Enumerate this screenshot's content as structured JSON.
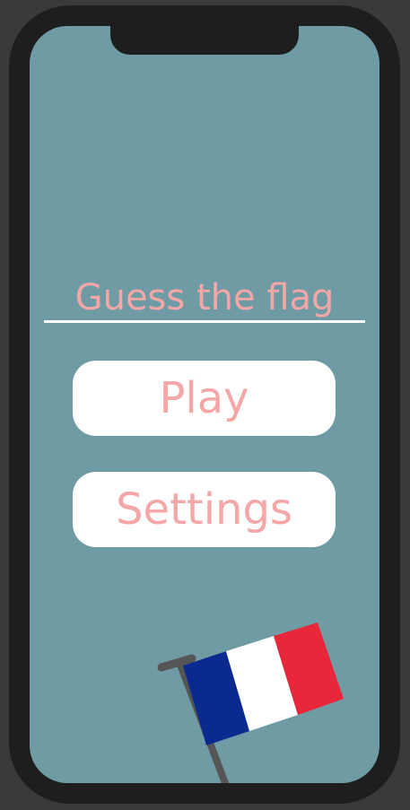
{
  "app": {
    "title": "Guess the flag"
  },
  "menu": {
    "play_label": "Play",
    "settings_label": "Settings"
  },
  "decoration": {
    "icon": "french-flag-icon",
    "flag_colors": [
      "#0a2a8f",
      "#ffffff",
      "#e8283a"
    ],
    "pole_color": "#555555"
  },
  "colors": {
    "background": "#6e9ba4",
    "accent_text": "#f4a7a6",
    "button_bg": "#ffffff"
  }
}
